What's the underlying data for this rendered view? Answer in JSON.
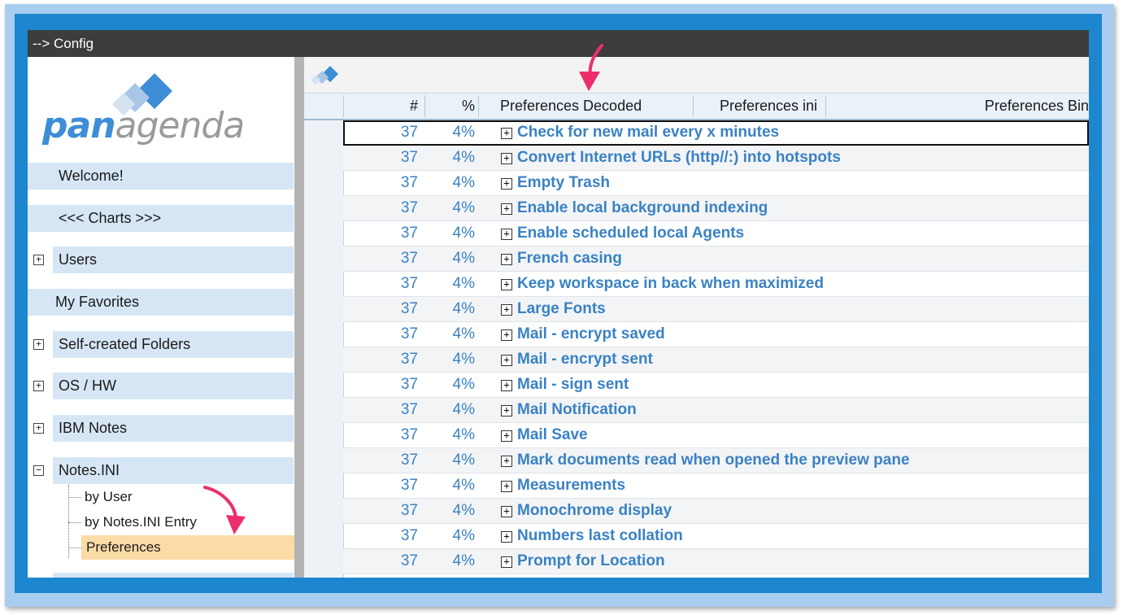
{
  "window": {
    "title": "--> Config"
  },
  "logo": {
    "pan": "pan",
    "agenda": "agenda"
  },
  "sidebar": {
    "items": [
      {
        "label": "Welcome!"
      },
      {
        "label": "<<< Charts >>>"
      },
      {
        "label": "Users",
        "expander": "+"
      },
      {
        "label": "My Favorites"
      },
      {
        "label": "Self-created Folders",
        "expander": "+"
      },
      {
        "label": "OS / HW",
        "expander": "+"
      },
      {
        "label": "IBM Notes",
        "expander": "+"
      },
      {
        "label": "Notes.INI",
        "expander": "−"
      }
    ],
    "subitems": [
      {
        "label": "by User"
      },
      {
        "label": "by Notes.INI Entry"
      },
      {
        "label": "Preferences"
      }
    ]
  },
  "table": {
    "columns": [
      "#",
      "%",
      "Preferences Decoded",
      "Preferences ini",
      "Preferences Bin"
    ],
    "expander": "+",
    "rows": [
      {
        "count": "37",
        "pct": "4%",
        "pref": "Check for new mail every x minutes"
      },
      {
        "count": "37",
        "pct": "4%",
        "pref": "Convert Internet URLs (http//:) into hotspots"
      },
      {
        "count": "37",
        "pct": "4%",
        "pref": "Empty Trash"
      },
      {
        "count": "37",
        "pct": "4%",
        "pref": "Enable local background indexing"
      },
      {
        "count": "37",
        "pct": "4%",
        "pref": "Enable scheduled local Agents"
      },
      {
        "count": "37",
        "pct": "4%",
        "pref": "French casing"
      },
      {
        "count": "37",
        "pct": "4%",
        "pref": "Keep workspace in back when maximized"
      },
      {
        "count": "37",
        "pct": "4%",
        "pref": "Large Fonts"
      },
      {
        "count": "37",
        "pct": "4%",
        "pref": "Mail - encrypt saved"
      },
      {
        "count": "37",
        "pct": "4%",
        "pref": "Mail - encrypt sent"
      },
      {
        "count": "37",
        "pct": "4%",
        "pref": "Mail - sign sent"
      },
      {
        "count": "37",
        "pct": "4%",
        "pref": "Mail Notification"
      },
      {
        "count": "37",
        "pct": "4%",
        "pref": "Mail Save"
      },
      {
        "count": "37",
        "pct": "4%",
        "pref": "Mark documents read when opened the preview pane"
      },
      {
        "count": "37",
        "pct": "4%",
        "pref": "Measurements"
      },
      {
        "count": "37",
        "pct": "4%",
        "pref": "Monochrome display"
      },
      {
        "count": "37",
        "pct": "4%",
        "pref": "Numbers last collation"
      },
      {
        "count": "37",
        "pct": "4%",
        "pref": "Prompt for Location"
      }
    ]
  },
  "colors": {
    "accent": "#1c87cf",
    "link": "#3a82c4",
    "selected": "#fbdba6",
    "arrow": "#ec2f6b"
  }
}
